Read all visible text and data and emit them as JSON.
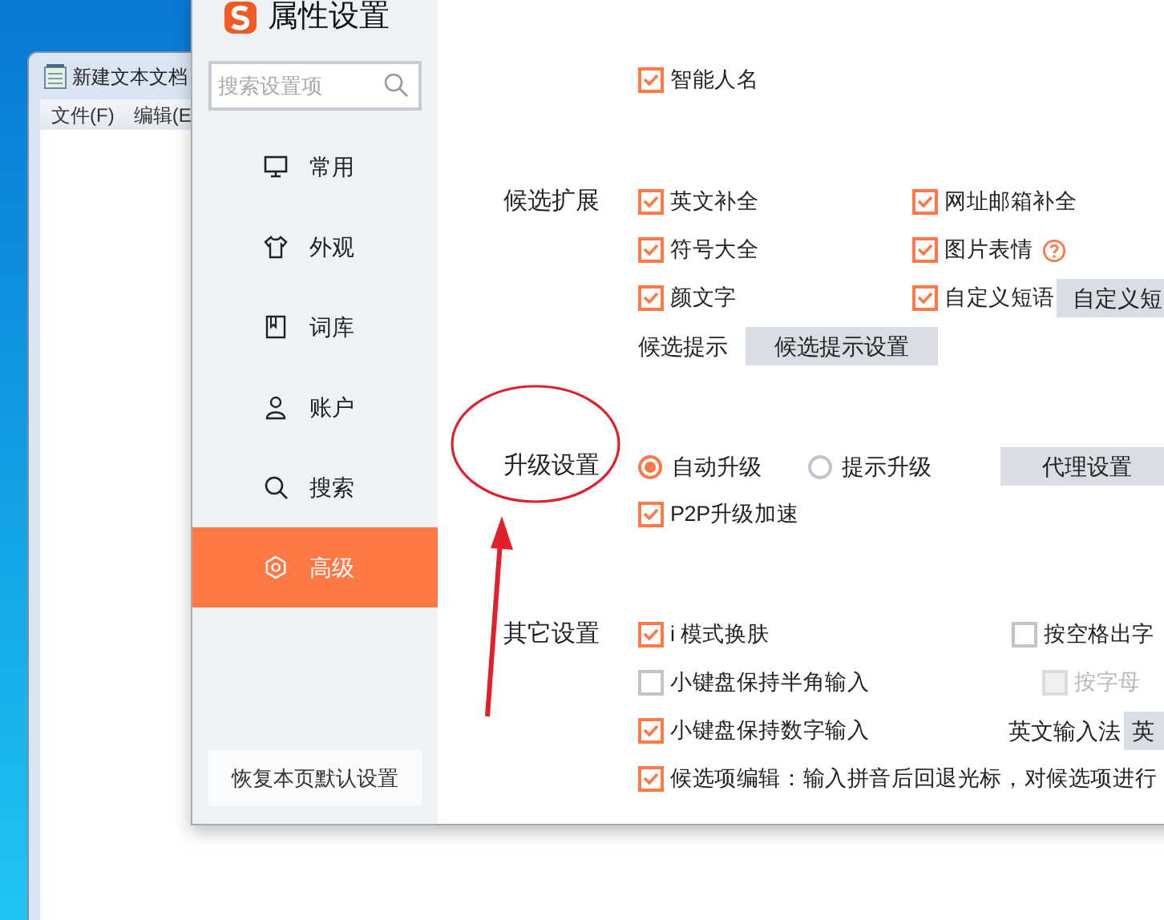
{
  "notepad": {
    "title": "新建文本文档",
    "menu": [
      "文件(F)",
      "编辑(E"
    ]
  },
  "dialog": {
    "title": "属性设置",
    "search": {
      "placeholder": "搜索设置项"
    },
    "sidebar": [
      {
        "label": "常用",
        "selected": false
      },
      {
        "label": "外观",
        "selected": false
      },
      {
        "label": "词库",
        "selected": false
      },
      {
        "label": "账户",
        "selected": false
      },
      {
        "label": "搜索",
        "selected": false
      },
      {
        "label": "高级",
        "selected": true
      }
    ],
    "restore_button": "恢复本页默认设置",
    "sections": [
      {
        "rows": [
          [
            {
              "kind": "checkbox",
              "label": "智能人名",
              "checked": true
            }
          ]
        ]
      },
      {
        "label": "候选扩展",
        "rows": [
          [
            {
              "kind": "checkbox",
              "label": "英文补全",
              "checked": true
            },
            {
              "kind": "checkbox",
              "label": "网址邮箱补全",
              "checked": true
            }
          ],
          [
            {
              "kind": "checkbox",
              "label": "符号大全",
              "checked": true
            },
            {
              "kind": "checkbox",
              "label": "图片表情",
              "checked": true,
              "help": true
            }
          ],
          [
            {
              "kind": "checkbox",
              "label": "颜文字",
              "checked": true
            },
            {
              "kind": "checkbox",
              "label": "自定义短语",
              "checked": true
            },
            {
              "kind": "button",
              "label": "自定义短"
            }
          ],
          [
            {
              "kind": "text",
              "label": "候选提示"
            },
            {
              "kind": "button",
              "label": "候选提示设置"
            }
          ]
        ]
      },
      {
        "label": "升级设置",
        "rows": [
          [
            {
              "kind": "radio",
              "label": "自动升级",
              "selected": true
            },
            {
              "kind": "radio",
              "label": "提示升级",
              "selected": false
            },
            {
              "kind": "button",
              "label": "代理设置"
            }
          ],
          [
            {
              "kind": "checkbox",
              "label": "P2P升级加速",
              "checked": true
            }
          ]
        ]
      },
      {
        "label": "其它设置",
        "rows": [
          [
            {
              "kind": "checkbox",
              "label": "i 模式换肤",
              "checked": true
            },
            {
              "kind": "checkbox",
              "label": "按空格出字",
              "checked": false
            }
          ],
          [
            {
              "kind": "checkbox",
              "label": "小键盘保持半角输入",
              "checked": false
            },
            {
              "kind": "checkbox",
              "label": "按字母",
              "checked": false,
              "disabled": true
            }
          ],
          [
            {
              "kind": "checkbox",
              "label": "小键盘保持数字输入",
              "checked": true
            },
            {
              "kind": "text",
              "label": "英文输入法"
            },
            {
              "kind": "button",
              "label": "英"
            }
          ],
          [
            {
              "kind": "checkbox",
              "label": "候选项编辑：输入拼音后回退光标，对候选项进行",
              "checked": true
            }
          ]
        ]
      }
    ]
  }
}
